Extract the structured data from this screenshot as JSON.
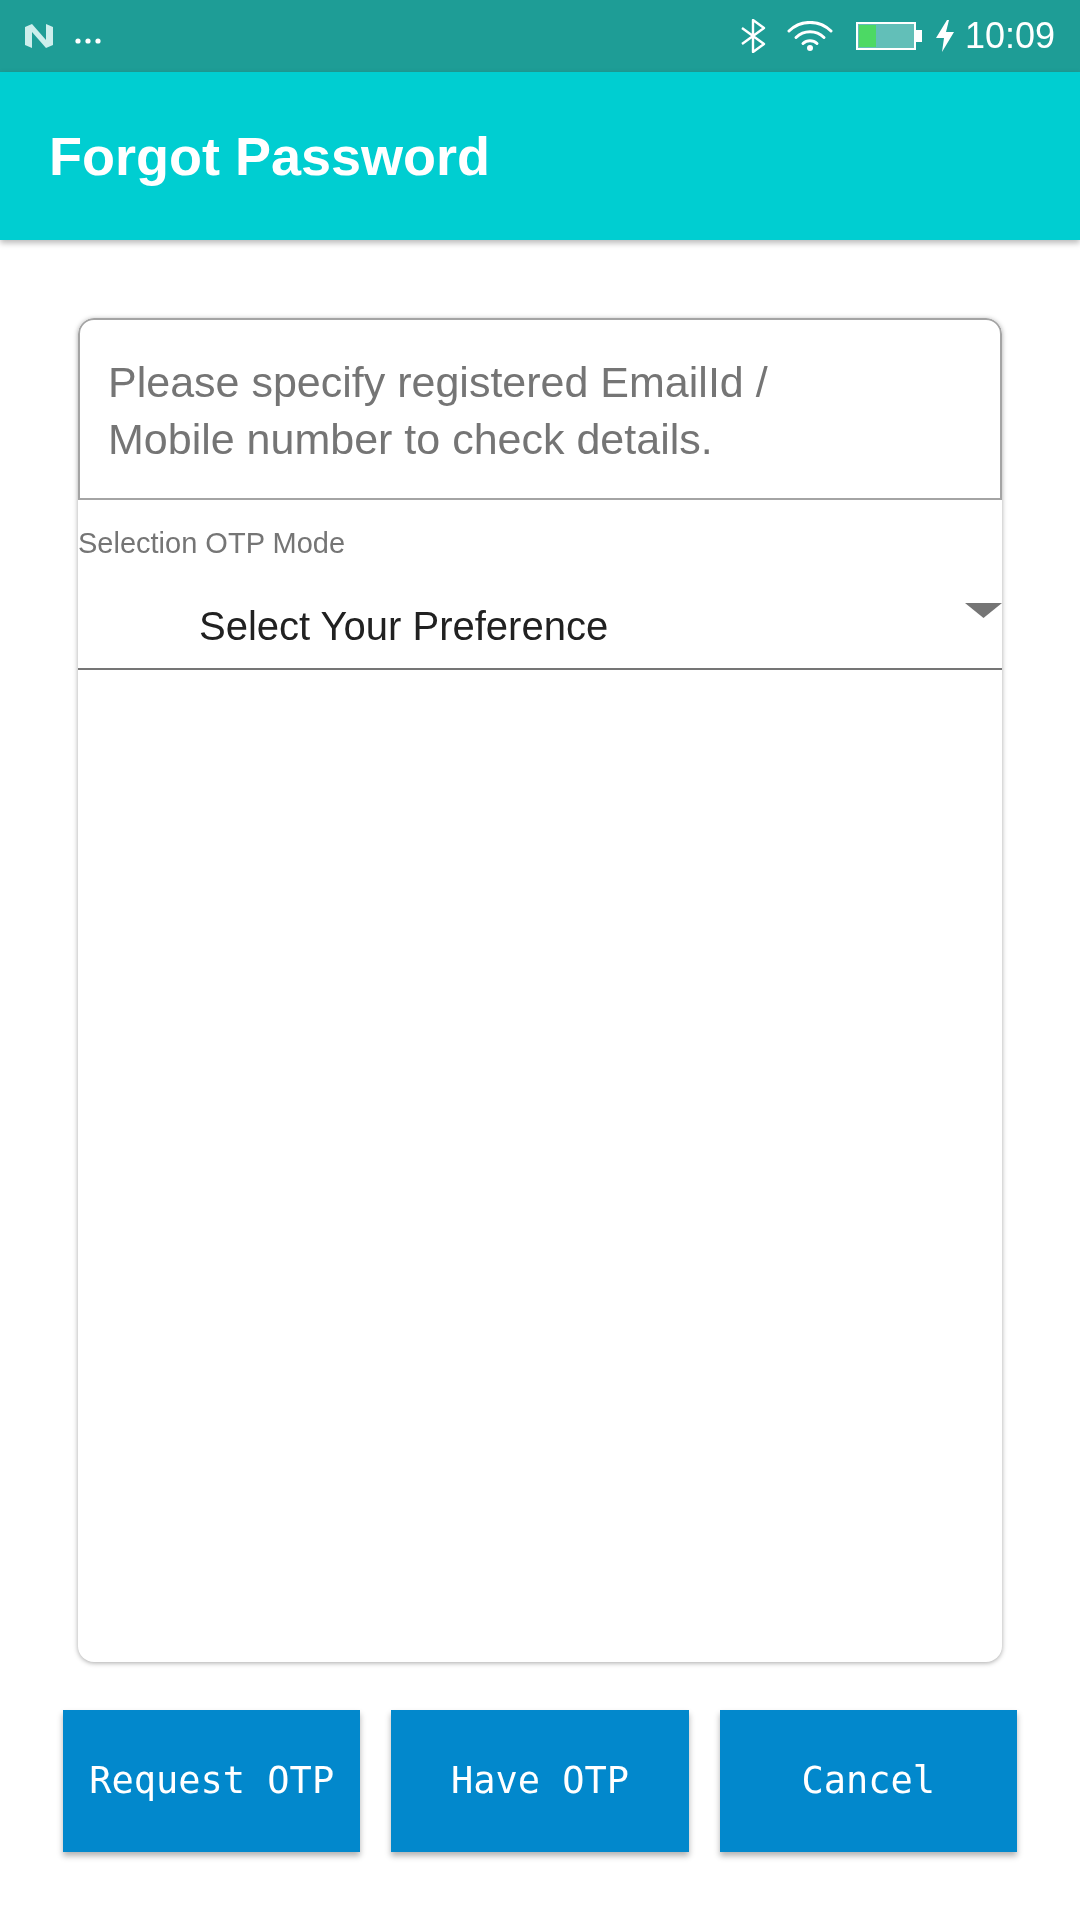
{
  "status_bar": {
    "time": "10:09"
  },
  "app_bar": {
    "title": "Forgot Password"
  },
  "form": {
    "contact_field": {
      "placeholder": "Please specify registered EmailId / Mobile number to check details."
    },
    "otp_mode": {
      "label": "Selection OTP Mode",
      "value": "Select Your Preference"
    }
  },
  "buttons": [
    {
      "label": "Request OTP"
    },
    {
      "label": "Have OTP"
    },
    {
      "label": "Cancel"
    }
  ]
}
